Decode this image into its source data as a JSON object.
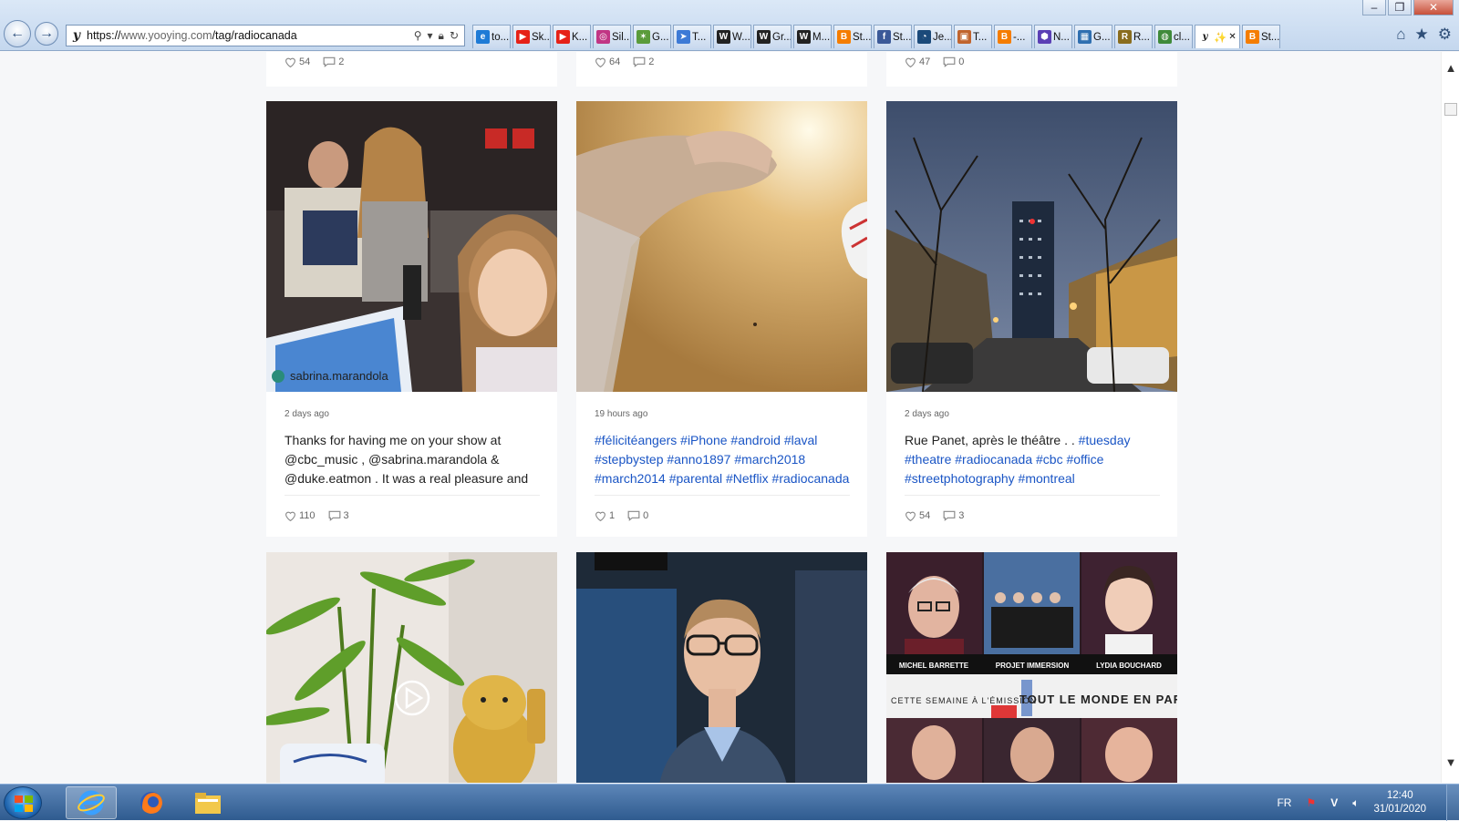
{
  "browser": {
    "url_prefix": "https://",
    "url_domain": "www.yooying.com",
    "url_path": "/tag/radiocanada",
    "tabs": [
      {
        "label": "to...",
        "icon": "ie-icon",
        "color": "#1e7bd6"
      },
      {
        "label": "Sk...",
        "icon": "youtube-icon",
        "color": "#e62117"
      },
      {
        "label": "K...",
        "icon": "youtube-icon",
        "color": "#e62117"
      },
      {
        "label": "Sil...",
        "icon": "instagram-icon",
        "color": "#c13584"
      },
      {
        "label": "G...",
        "icon": "map-icon",
        "color": "#5a9b3a"
      },
      {
        "label": "T...",
        "icon": "arrow-icon",
        "color": "#3d7ad6"
      },
      {
        "label": "W...",
        "icon": "wikipedia-icon",
        "color": "#222222"
      },
      {
        "label": "Gr...",
        "icon": "wikipedia-icon",
        "color": "#222222"
      },
      {
        "label": "M...",
        "icon": "wikipedia-icon",
        "color": "#222222"
      },
      {
        "label": "St...",
        "icon": "blogger-icon",
        "color": "#f57d00"
      },
      {
        "label": "St...",
        "icon": "facebook-icon",
        "color": "#3b5998"
      },
      {
        "label": "Je...",
        "icon": "circle-icon",
        "color": "#1b4a7a"
      },
      {
        "label": "T...",
        "icon": "image-icon",
        "color": "#c0642e"
      },
      {
        "label": "-...",
        "icon": "blogger-icon",
        "color": "#f57d00"
      },
      {
        "label": "N...",
        "icon": "hexagon-icon",
        "color": "#5b3fb5"
      },
      {
        "label": "G...",
        "icon": "grid-icon",
        "color": "#2f6fb0"
      },
      {
        "label": "R...",
        "icon": "app-icon",
        "color": "#8a6d1e"
      },
      {
        "label": "cl...",
        "icon": "globe-icon",
        "color": "#3f8a3a"
      },
      {
        "label": "✨",
        "icon": "yooying-icon",
        "color": "#111111",
        "active": true
      },
      {
        "label": "St...",
        "icon": "blogger-icon",
        "color": "#f57d00"
      }
    ]
  },
  "top_row": [
    {
      "likes": "54",
      "comments": "2"
    },
    {
      "likes": "64",
      "comments": "2"
    },
    {
      "likes": "47",
      "comments": "0"
    }
  ],
  "posts": [
    {
      "author": "sabrina.marandola",
      "time": "2 days ago",
      "caption_html": "Thanks for having me on your show at @cbc_music , @sabrina.marandola &amp; @duke.eatmon . It was a real pleasure and",
      "likes": "110",
      "comments": "3"
    },
    {
      "author": "",
      "time": "19 hours ago",
      "caption_html": "<span class=\"tag\">#félicitéangers #iPhone #android #laval #stepbystep #anno1897 #march2018 #march2014 #parental #Netflix #radiocanada</span>",
      "likes": "1",
      "comments": "0"
    },
    {
      "author": "",
      "time": "2 days ago",
      "caption_html": "Rue Panet, après le théâtre . . <span class=\"tag\">#tuesday #theatre #radiocanada #cbc #office #streetphotography #montreal</span>",
      "likes": "54",
      "comments": "3"
    }
  ],
  "tlmep": {
    "names": [
      "MICHEL BARRETTE",
      "PROJET IMMERSION",
      "LYDIA BOUCHARD"
    ],
    "banner_small": "CETTE SEMAINE À L'ÉMISSION",
    "banner_big": "TOUT LE MONDE EN PARLE"
  },
  "taskbar": {
    "lang": "FR",
    "time": "12:40",
    "date": "31/01/2020"
  }
}
